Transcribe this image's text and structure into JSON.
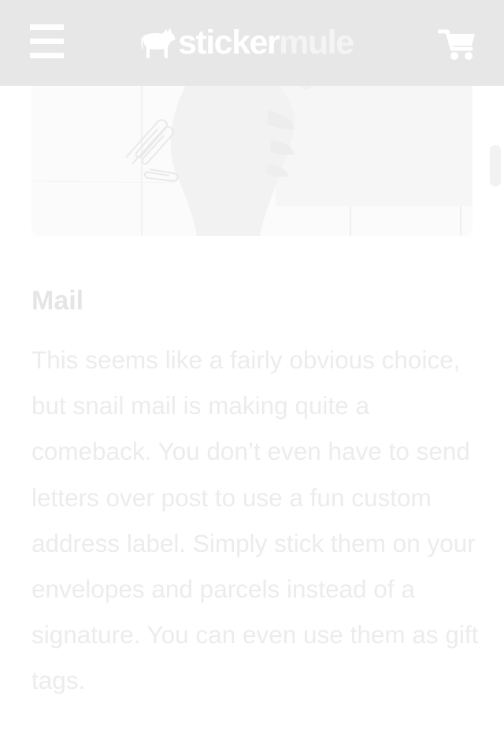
{
  "header": {
    "logo": {
      "part1": "sticker",
      "part2": "mule"
    },
    "menu_icon": "hamburger-menu-icon",
    "cart_icon": "shopping-cart-icon"
  },
  "article": {
    "hero_image": "hand holding a sheet of paper beside paper clips on a white desk",
    "section_title": "Mail",
    "paragraph": "This seems like a fairly obvious choice, but snail mail is making quite a comeback. You don’t even have to send letters over post to use a fun custom address label. Simply stick them on your envelopes and parcels instead of a signature. You can even use them as gift tags."
  },
  "colors": {
    "header_bg": "#e7e7e7",
    "header_icons": "#ffffff",
    "title_text": "#e5e5e5",
    "body_text": "#ececec"
  }
}
